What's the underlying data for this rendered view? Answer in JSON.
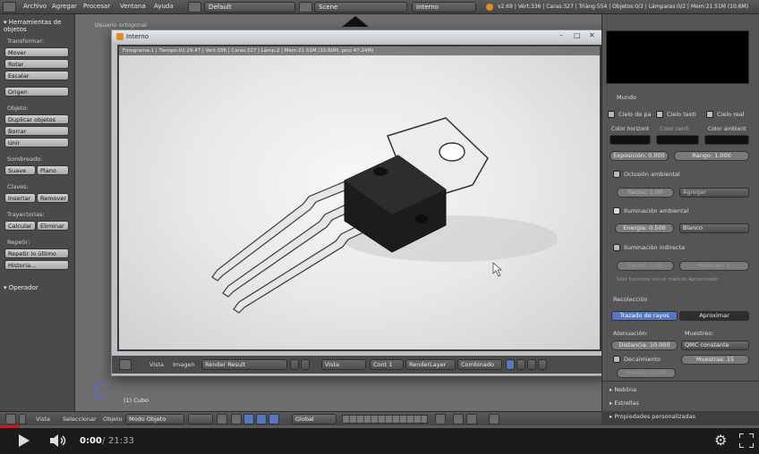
{
  "topbar": {
    "menus": [
      "Archivo",
      "Agregar",
      "Procesar",
      "Ventana",
      "Ayuda"
    ],
    "layout_field": "Default",
    "scene_field": "Scene",
    "engine_field": "Interno",
    "stats": "v2.69 | Vért:336 | Caras:327 | Triáng:554 | Objetos:0/2 | Lámparas:0/2 | Mem:21.51M (10.6M)"
  },
  "shelf": {
    "header": "Herramientas de objetos",
    "sections": [
      {
        "label": "Transformar:",
        "buttons": [
          "Mover",
          "Rotar",
          "Escalar"
        ]
      },
      {
        "label": "",
        "buttons": [
          "Origen"
        ]
      },
      {
        "label": "Objeto:",
        "buttons": [
          "Duplicar objetos",
          "Borrar",
          "Unir"
        ]
      },
      {
        "label": "Sombreado:",
        "pair": [
          "Suave",
          "Plano"
        ]
      },
      {
        "label": "Claves:",
        "pair": [
          "Insertar",
          "Remover"
        ]
      },
      {
        "label": "Trayectorias:",
        "pair": [
          "Calcular",
          "Eliminar"
        ]
      },
      {
        "label": "Repetir:",
        "buttons": [
          "Repetir lo último",
          "Historia..."
        ]
      }
    ],
    "operator_header": "Operador"
  },
  "viewport": {
    "view_label": "Usuario ortogonal",
    "object_label": "(1) Cubo"
  },
  "render_window": {
    "title": "Interno",
    "stats": "Fotograma:1 | Tiempo:02:29.47 | Vért:336 | Caras:327 | Lámp:2 | Mem:21.51M (10.60M, pico 47.24M)",
    "bar": {
      "view": "Vista",
      "image": "Imagen",
      "image_name": "Render Result",
      "slot_view": "Vista",
      "slot": "Cont 1",
      "layer": "RenderLayer",
      "pass": "Combinado"
    }
  },
  "props": {
    "mundo": "Mundo",
    "color_checks": [
      "Cielo de pa",
      "Cielo texti",
      "Cielo real"
    ],
    "color_labels": [
      "Color horizont",
      "Color cenit",
      "Color ambient"
    ],
    "exposure": "Exposición: 0.000",
    "range": "Rango: 1.000",
    "ambient_occlusion": "Oclusión ambiental",
    "ao_factor": "Factor: 1.00",
    "ao_blend": "Agregar",
    "env_lighting": "Iluminación ambiental",
    "energy": "Energía: 0.500",
    "env_color": "Blanco",
    "indirect": "Iluminación indirecta",
    "indirect_factor": "Factor: 1.00",
    "bounces": "Rebotes: 1",
    "indirect_note": "Sólo funciona con el método Aproximado",
    "gather": "Recolección",
    "raytrace": "Trazado de rayos",
    "approx": "Aproximar",
    "attenuation": "Atenuación:",
    "sampling": "Muestreo:",
    "distance": "Distancia: 10.000",
    "sampling_method": "QMC constante",
    "falloff": "Decaimiento",
    "samples": "Muestras: 15",
    "strength": "Fuerza: 0.000",
    "mist": "Neblina",
    "stars": "Estrellas",
    "custom": "Propiedades personalizadas"
  },
  "viewport_header": {
    "view": "Vista",
    "select": "Seleccionar",
    "object": "Objeto",
    "mode": "Modo Objeto",
    "orientation": "Global"
  },
  "player": {
    "current": "0:00",
    "separator": "/",
    "total": "21:33",
    "progress": 0.0
  }
}
